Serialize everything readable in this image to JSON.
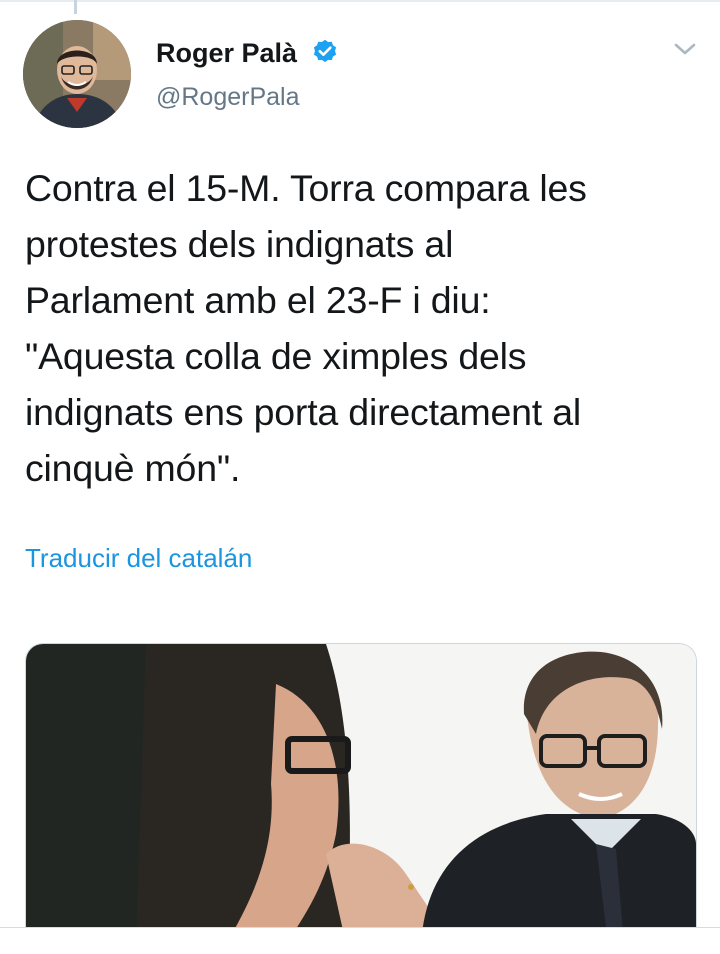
{
  "tweet": {
    "author_name": "Roger Palà",
    "author_handle": "@RogerPala",
    "text": "Contra el 15-M. Torra compara les\nprotestes dels indignats al\nParlament amb el 23-F i diu:\n\"Aquesta colla de ximples dels\nindignats ens porta directament al\ncinquè món\".",
    "translate_label": "Traducir del catalán",
    "accent_color": "#1b95e0",
    "icons": [
      "verified-badge-icon",
      "chevron-down-icon"
    ]
  }
}
